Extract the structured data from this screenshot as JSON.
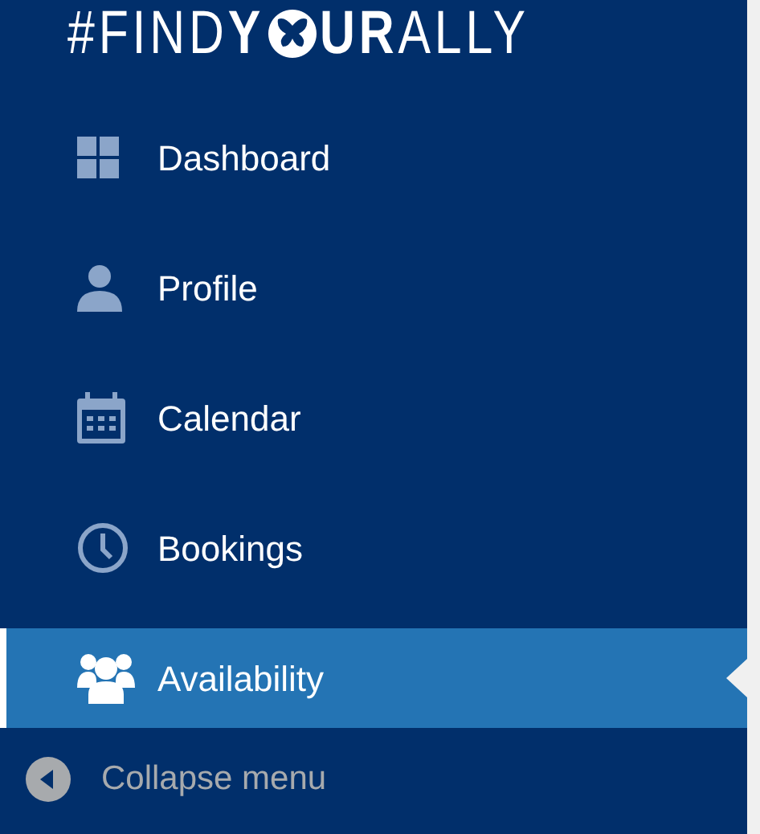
{
  "logo": {
    "lead": "#",
    "find": "FIND",
    "y": "Y",
    "ur": "UR",
    "ally": "ALLY"
  },
  "menu": [
    {
      "label": "Dashboard",
      "kind": "grid",
      "selected": false
    },
    {
      "label": "Profile",
      "kind": "person",
      "selected": false
    },
    {
      "label": "Calendar",
      "kind": "calendar",
      "selected": false
    },
    {
      "label": "Bookings",
      "kind": "clock",
      "selected": false
    },
    {
      "label": "Availability",
      "kind": "group",
      "selected": true
    }
  ],
  "collapse": {
    "label": "Collapse menu"
  }
}
